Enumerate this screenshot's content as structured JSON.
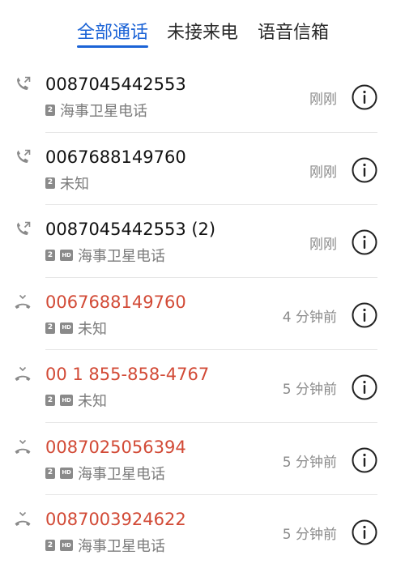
{
  "tabs": [
    {
      "label": "全部通话",
      "active": true
    },
    {
      "label": "未接来电",
      "active": false
    },
    {
      "label": "语音信箱",
      "active": false
    }
  ],
  "colors": {
    "accent": "#1b63d6",
    "missed": "#d24a36",
    "secondary": "#8a8a8a"
  },
  "calls": [
    {
      "number": "0087045442553",
      "location": "海事卫星电话",
      "time": "刚刚",
      "type": "outgoing",
      "sim": "2",
      "hd": false
    },
    {
      "number": "0067688149760",
      "location": "未知",
      "time": "刚刚",
      "type": "outgoing",
      "sim": "2",
      "hd": false
    },
    {
      "number": "0087045442553 (2)",
      "location": "海事卫星电话",
      "time": "刚刚",
      "type": "outgoing",
      "sim": "2",
      "hd": true
    },
    {
      "number": "0067688149760",
      "location": "未知",
      "time": "4 分钟前",
      "type": "missed",
      "sim": "2",
      "hd": true
    },
    {
      "number": "00 1 855-858-4767",
      "location": "未知",
      "time": "5 分钟前",
      "type": "missed",
      "sim": "2",
      "hd": true
    },
    {
      "number": "0087025056394",
      "location": "海事卫星电话",
      "time": "5 分钟前",
      "type": "missed",
      "sim": "2",
      "hd": true
    },
    {
      "number": "0087003924622",
      "location": "海事卫星电话",
      "time": "5 分钟前",
      "type": "missed",
      "sim": "2",
      "hd": true
    }
  ],
  "badges": {
    "hd_label": "HD"
  },
  "icons": {
    "outgoing": "outgoing-call-icon",
    "missed": "missed-call-icon",
    "info": "info-icon"
  }
}
